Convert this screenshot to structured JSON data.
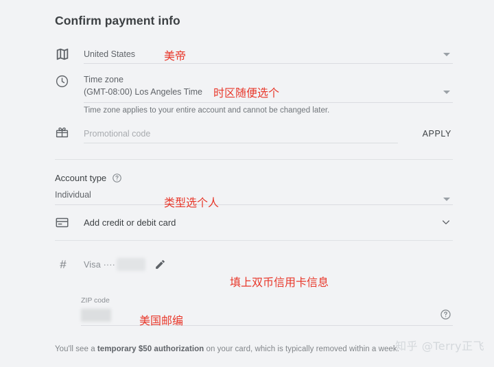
{
  "page": {
    "title": "Confirm payment info",
    "background_color": "#f2f3f5",
    "annotation_color": "#e8382b"
  },
  "country": {
    "icon": "map-icon",
    "value": "United States",
    "dropdown_icon": "caret-down-icon"
  },
  "timezone": {
    "icon": "clock-icon",
    "label": "Time zone",
    "value": "(GMT-08:00) Los Angeles Time",
    "helper": "Time zone applies to your entire account and cannot be changed later.",
    "dropdown_icon": "caret-down-icon"
  },
  "promo": {
    "icon": "gift-icon",
    "placeholder": "Promotional code",
    "value": "",
    "apply_label": "APPLY"
  },
  "account_type": {
    "label": "Account type",
    "help_icon": "help-circle-icon",
    "value": "Individual",
    "dropdown_icon": "caret-down-icon"
  },
  "add_card": {
    "icon": "credit-card-icon",
    "label": "Add credit or debit card",
    "expander_icon": "chevron-down-icon"
  },
  "saved_card": {
    "icon": "hash-icon",
    "hash_glyph": "#",
    "brand_masked": "Visa  ····",
    "edit_icon": "pencil-icon",
    "redacted": true
  },
  "zip": {
    "label": "ZIP code",
    "value": "",
    "redacted": true,
    "help_icon": "help-circle-icon"
  },
  "footer": {
    "prefix": "You'll see a ",
    "emphasis": "temporary $50 authorization",
    "suffix": " on your card, which is typically removed within a week."
  },
  "annotations": {
    "country": "美帝",
    "timezone": "时区随便选个",
    "account_type": "类型选个人",
    "card": "填上双币信用卡信息",
    "zip": "美国邮编"
  },
  "watermark": {
    "text": "知乎 @Terry正飞"
  }
}
